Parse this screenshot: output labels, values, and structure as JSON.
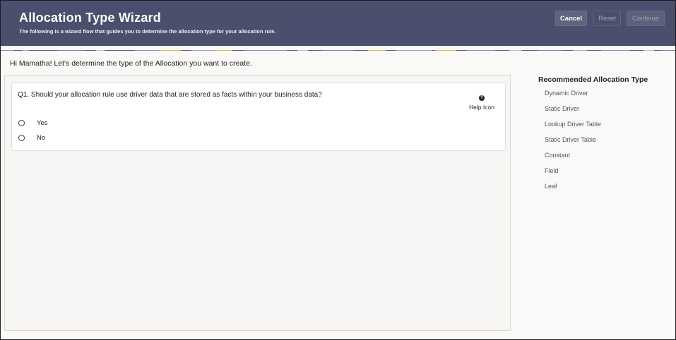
{
  "header": {
    "title": "Allocation Type Wizard",
    "subtitle": "The following is a wizard flow that guides you to determine the allocation type for your allocation rule.",
    "cancel_label": "Cancel",
    "reset_label": "Reset",
    "continue_label": "Continue"
  },
  "greeting": "Hi Mamatha! Let's determine the type of the Allocation you want to create.",
  "question": {
    "text": "Q1. Should your allocation rule use driver data that are stored as facts within your business data?",
    "help_label": "Help Icon",
    "options": [
      {
        "label": "Yes"
      },
      {
        "label": "No"
      }
    ]
  },
  "sidebar": {
    "title": "Recommended Allocation Type",
    "items": [
      {
        "label": "Dynamic Driver"
      },
      {
        "label": "Static Driver"
      },
      {
        "label": "Lookup Driver Table"
      },
      {
        "label": "Static Driver Table"
      },
      {
        "label": "Constant"
      },
      {
        "label": "Field"
      },
      {
        "label": "Leaf"
      }
    ]
  },
  "colors": {
    "header_bg": "#4a4f6e",
    "banner_yellow": "#e8b84a",
    "banner_blue": "#8a90b8"
  }
}
